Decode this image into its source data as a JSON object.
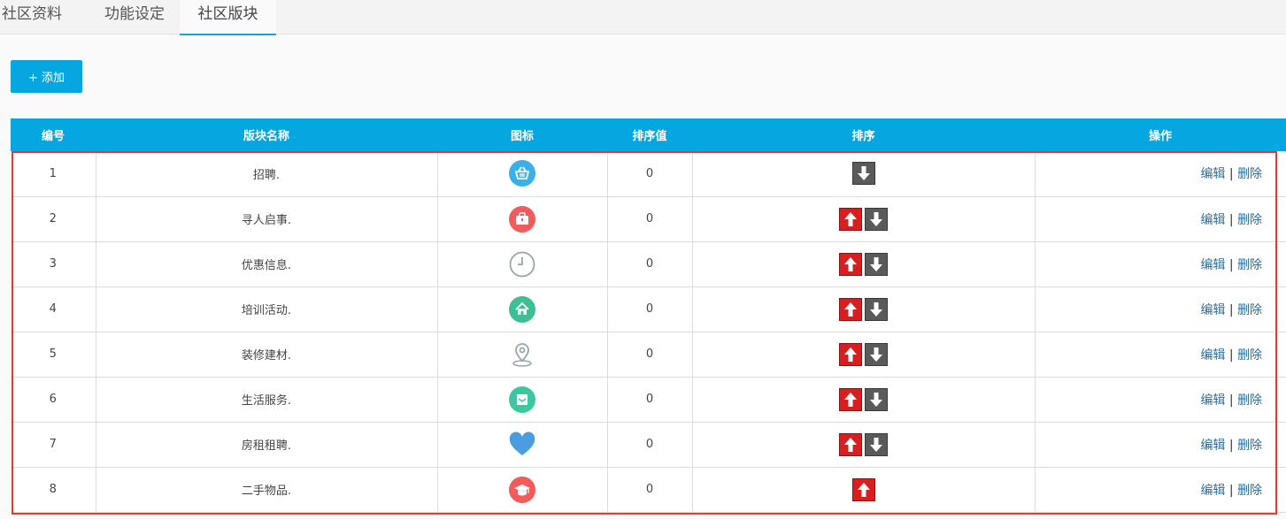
{
  "tabs": [
    {
      "label": "社区资料"
    },
    {
      "label": "功能设定"
    },
    {
      "label": "社区版块"
    }
  ],
  "toolbar": {
    "add_label": "+ 添加"
  },
  "table": {
    "headers": [
      "编号",
      "版块名称",
      "图标",
      "排序值",
      "排序",
      "操作"
    ],
    "edit_label": "编辑",
    "separator": "|",
    "delete_label": "删除",
    "rows": [
      {
        "id": "1",
        "name": "招聘.",
        "icon": "shopping-basket-icon",
        "icon_color": "#3ab0e8",
        "order": "0",
        "has_up": false,
        "has_down": true
      },
      {
        "id": "2",
        "name": "寻人启事.",
        "icon": "briefcase-icon",
        "icon_color": "#f15b5b",
        "order": "0",
        "has_up": true,
        "has_down": true
      },
      {
        "id": "3",
        "name": "优惠信息.",
        "icon": "clock-icon",
        "icon_color": "#9aa3ad",
        "order": "0",
        "has_up": true,
        "has_down": true
      },
      {
        "id": "4",
        "name": "培训活动.",
        "icon": "home-icon",
        "icon_color": "#3dbf93",
        "order": "0",
        "has_up": true,
        "has_down": true
      },
      {
        "id": "5",
        "name": "装修建材.",
        "icon": "map-pin-icon",
        "icon_color": "#9aa3ad",
        "order": "0",
        "has_up": true,
        "has_down": true
      },
      {
        "id": "6",
        "name": "生活服务.",
        "icon": "mail-icon",
        "icon_color": "#3dc7a0",
        "order": "0",
        "has_up": true,
        "has_down": true
      },
      {
        "id": "7",
        "name": "房租租聘.",
        "icon": "heart-icon",
        "icon_color": "#4a9de0",
        "order": "0",
        "has_up": true,
        "has_down": true
      },
      {
        "id": "8",
        "name": "二手物品.",
        "icon": "graduation-cap-icon",
        "icon_color": "#f15b5b",
        "order": "0",
        "has_up": true,
        "has_down": false
      }
    ]
  }
}
